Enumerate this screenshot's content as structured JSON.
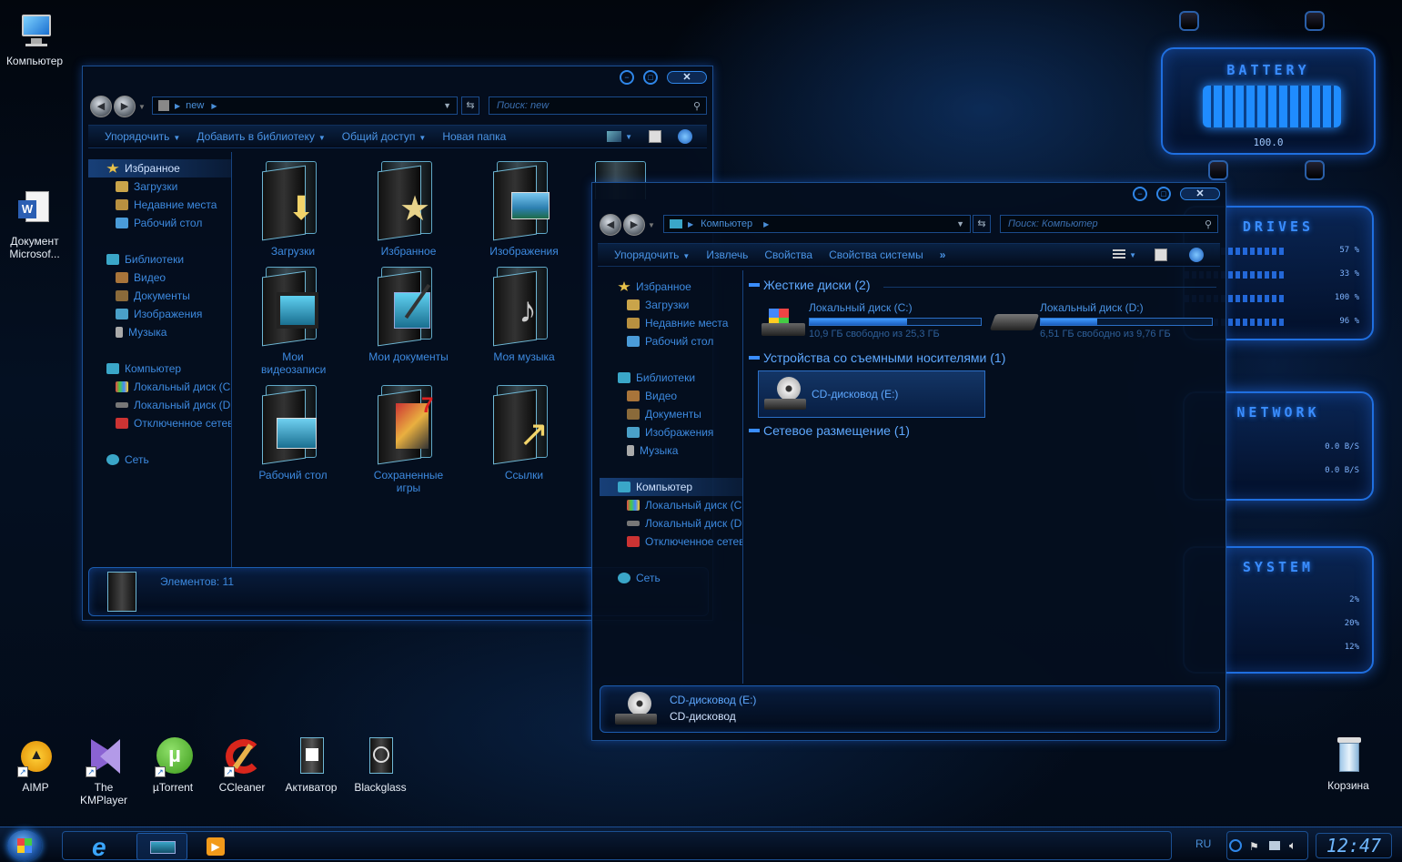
{
  "desktop": {
    "icons_top": [
      {
        "label": "Компьютер",
        "name": "computer"
      },
      {
        "label": "Документ Microsof...",
        "name": "word-document"
      }
    ],
    "icons_bottom": [
      {
        "label": "AIMP",
        "name": "aimp"
      },
      {
        "label": "The KMPlayer",
        "name": "kmplayer"
      },
      {
        "label": "µTorrent",
        "name": "utorrent"
      },
      {
        "label": "CCleaner",
        "name": "ccleaner"
      },
      {
        "label": "Активатор",
        "name": "activator"
      },
      {
        "label": "Blackglass",
        "name": "blackglass"
      }
    ],
    "recycle_bin": "Корзина"
  },
  "widgets": {
    "battery": {
      "title": "BATTERY",
      "value": "100.0"
    },
    "drives": {
      "title": "DRIVES",
      "rows": [
        "57 %",
        "33 %",
        "100 %",
        "96 %"
      ]
    },
    "network": {
      "title": "NETWORK",
      "rows": [
        "0.0 B/S",
        "0.0 B/S"
      ]
    },
    "system": {
      "title": "SYSTEM",
      "rows": [
        "2%",
        "20%",
        "12%"
      ]
    }
  },
  "window1": {
    "address": {
      "segment": "new"
    },
    "search_placeholder": "Поиск: new",
    "toolbar": {
      "organize": "Упорядочить",
      "add_to_library": "Добавить в библиотеку",
      "share": "Общий доступ",
      "new_folder": "Новая папка"
    },
    "nav": {
      "favorites": "Избранное",
      "downloads": "Загрузки",
      "recent": "Недавние места",
      "desktop": "Рабочий стол",
      "libraries": "Библиотеки",
      "video": "Видео",
      "documents": "Документы",
      "images": "Изображения",
      "music": "Музыка",
      "computer": "Компьютер",
      "local_c": "Локальный диск (C:)",
      "local_d": "Локальный диск (D:)",
      "disconnected": "Отключенное сетевое",
      "network": "Сеть"
    },
    "folders": [
      {
        "label": "Загрузки",
        "name": "downloads"
      },
      {
        "label": "Избранное",
        "name": "favorites"
      },
      {
        "label": "Изображения",
        "name": "images"
      },
      {
        "label": "Мои видеозаписи",
        "name": "my-videos"
      },
      {
        "label": "Мои документы",
        "name": "my-documents"
      },
      {
        "label": "Моя музыка",
        "name": "my-music"
      },
      {
        "label": "Рабочий стол",
        "name": "desktop"
      },
      {
        "label": "Сохраненные игры",
        "name": "saved-games"
      },
      {
        "label": "Ссылки",
        "name": "links"
      }
    ],
    "status": "Элементов: 11"
  },
  "window2": {
    "address": {
      "segment": "Компьютер"
    },
    "search_placeholder": "Поиск: Компьютер",
    "toolbar": {
      "organize": "Упорядочить",
      "eject": "Извлечь",
      "properties": "Свойства",
      "system_properties": "Свойства системы",
      "more": "»"
    },
    "nav": {
      "favorites": "Избранное",
      "downloads": "Загрузки",
      "recent": "Недавние места",
      "desktop": "Рабочий стол",
      "libraries": "Библиотеки",
      "video": "Видео",
      "documents": "Документы",
      "images": "Изображения",
      "music": "Музыка",
      "computer": "Компьютер",
      "local_c": "Локальный диск (C:)",
      "local_d": "Локальный диск (D:)",
      "disconnected": "Отключенное сетевое",
      "network": "Сеть"
    },
    "groups": {
      "hard_disks": "Жесткие диски (2)",
      "removable": "Устройства со съемными носителями (1)",
      "network_locations": "Сетевое размещение (1)"
    },
    "drives": [
      {
        "name": "Локальный диск (C:)",
        "free": "10,9 ГБ свободно из 25,3 ГБ",
        "used_fraction": 0.57
      },
      {
        "name": "Локальный диск (D:)",
        "free": "6,51 ГБ свободно из 9,76 ГБ",
        "used_fraction": 0.33
      }
    ],
    "cd_drive": "CD-дисковод (E:)",
    "details": {
      "title": "CD-дисковод (E:)",
      "subtitle": "CD-дисковод"
    }
  },
  "taskbar": {
    "language": "RU",
    "clock": "12:47"
  },
  "colors": {
    "accent": "#3a8dff",
    "text": "#3d8ae0",
    "border": "#1b4f92"
  }
}
